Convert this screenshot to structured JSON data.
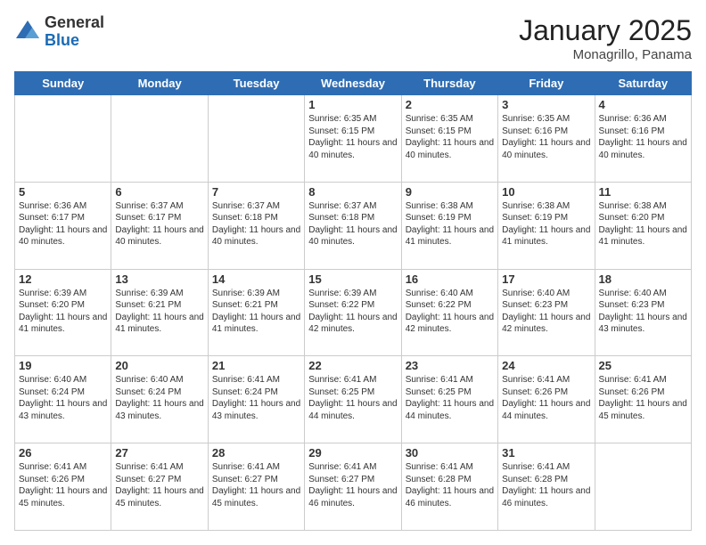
{
  "logo": {
    "general": "General",
    "blue": "Blue"
  },
  "header": {
    "month": "January 2025",
    "location": "Monagrillo, Panama"
  },
  "weekdays": [
    "Sunday",
    "Monday",
    "Tuesday",
    "Wednesday",
    "Thursday",
    "Friday",
    "Saturday"
  ],
  "weeks": [
    [
      {
        "day": "",
        "info": ""
      },
      {
        "day": "",
        "info": ""
      },
      {
        "day": "",
        "info": ""
      },
      {
        "day": "1",
        "info": "Sunrise: 6:35 AM\nSunset: 6:15 PM\nDaylight: 11 hours and 40 minutes."
      },
      {
        "day": "2",
        "info": "Sunrise: 6:35 AM\nSunset: 6:15 PM\nDaylight: 11 hours and 40 minutes."
      },
      {
        "day": "3",
        "info": "Sunrise: 6:35 AM\nSunset: 6:16 PM\nDaylight: 11 hours and 40 minutes."
      },
      {
        "day": "4",
        "info": "Sunrise: 6:36 AM\nSunset: 6:16 PM\nDaylight: 11 hours and 40 minutes."
      }
    ],
    [
      {
        "day": "5",
        "info": "Sunrise: 6:36 AM\nSunset: 6:17 PM\nDaylight: 11 hours and 40 minutes."
      },
      {
        "day": "6",
        "info": "Sunrise: 6:37 AM\nSunset: 6:17 PM\nDaylight: 11 hours and 40 minutes."
      },
      {
        "day": "7",
        "info": "Sunrise: 6:37 AM\nSunset: 6:18 PM\nDaylight: 11 hours and 40 minutes."
      },
      {
        "day": "8",
        "info": "Sunrise: 6:37 AM\nSunset: 6:18 PM\nDaylight: 11 hours and 40 minutes."
      },
      {
        "day": "9",
        "info": "Sunrise: 6:38 AM\nSunset: 6:19 PM\nDaylight: 11 hours and 41 minutes."
      },
      {
        "day": "10",
        "info": "Sunrise: 6:38 AM\nSunset: 6:19 PM\nDaylight: 11 hours and 41 minutes."
      },
      {
        "day": "11",
        "info": "Sunrise: 6:38 AM\nSunset: 6:20 PM\nDaylight: 11 hours and 41 minutes."
      }
    ],
    [
      {
        "day": "12",
        "info": "Sunrise: 6:39 AM\nSunset: 6:20 PM\nDaylight: 11 hours and 41 minutes."
      },
      {
        "day": "13",
        "info": "Sunrise: 6:39 AM\nSunset: 6:21 PM\nDaylight: 11 hours and 41 minutes."
      },
      {
        "day": "14",
        "info": "Sunrise: 6:39 AM\nSunset: 6:21 PM\nDaylight: 11 hours and 41 minutes."
      },
      {
        "day": "15",
        "info": "Sunrise: 6:39 AM\nSunset: 6:22 PM\nDaylight: 11 hours and 42 minutes."
      },
      {
        "day": "16",
        "info": "Sunrise: 6:40 AM\nSunset: 6:22 PM\nDaylight: 11 hours and 42 minutes."
      },
      {
        "day": "17",
        "info": "Sunrise: 6:40 AM\nSunset: 6:23 PM\nDaylight: 11 hours and 42 minutes."
      },
      {
        "day": "18",
        "info": "Sunrise: 6:40 AM\nSunset: 6:23 PM\nDaylight: 11 hours and 43 minutes."
      }
    ],
    [
      {
        "day": "19",
        "info": "Sunrise: 6:40 AM\nSunset: 6:24 PM\nDaylight: 11 hours and 43 minutes."
      },
      {
        "day": "20",
        "info": "Sunrise: 6:40 AM\nSunset: 6:24 PM\nDaylight: 11 hours and 43 minutes."
      },
      {
        "day": "21",
        "info": "Sunrise: 6:41 AM\nSunset: 6:24 PM\nDaylight: 11 hours and 43 minutes."
      },
      {
        "day": "22",
        "info": "Sunrise: 6:41 AM\nSunset: 6:25 PM\nDaylight: 11 hours and 44 minutes."
      },
      {
        "day": "23",
        "info": "Sunrise: 6:41 AM\nSunset: 6:25 PM\nDaylight: 11 hours and 44 minutes."
      },
      {
        "day": "24",
        "info": "Sunrise: 6:41 AM\nSunset: 6:26 PM\nDaylight: 11 hours and 44 minutes."
      },
      {
        "day": "25",
        "info": "Sunrise: 6:41 AM\nSunset: 6:26 PM\nDaylight: 11 hours and 45 minutes."
      }
    ],
    [
      {
        "day": "26",
        "info": "Sunrise: 6:41 AM\nSunset: 6:26 PM\nDaylight: 11 hours and 45 minutes."
      },
      {
        "day": "27",
        "info": "Sunrise: 6:41 AM\nSunset: 6:27 PM\nDaylight: 11 hours and 45 minutes."
      },
      {
        "day": "28",
        "info": "Sunrise: 6:41 AM\nSunset: 6:27 PM\nDaylight: 11 hours and 45 minutes."
      },
      {
        "day": "29",
        "info": "Sunrise: 6:41 AM\nSunset: 6:27 PM\nDaylight: 11 hours and 46 minutes."
      },
      {
        "day": "30",
        "info": "Sunrise: 6:41 AM\nSunset: 6:28 PM\nDaylight: 11 hours and 46 minutes."
      },
      {
        "day": "31",
        "info": "Sunrise: 6:41 AM\nSunset: 6:28 PM\nDaylight: 11 hours and 46 minutes."
      },
      {
        "day": "",
        "info": ""
      }
    ]
  ]
}
